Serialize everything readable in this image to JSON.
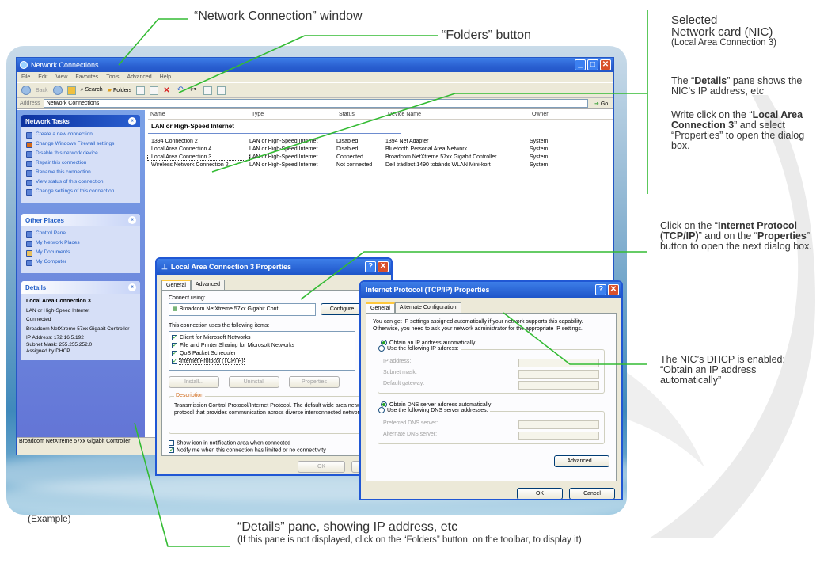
{
  "annotations": {
    "window_caption": "“Network Connection” window",
    "folders_caption": "“Folders” button",
    "nic_title_1": "Selected",
    "nic_title_2": "Network card (NIC)",
    "nic_title_3": "(Local Area Connection 3)",
    "details_note_1": "The “",
    "details_note_b": "Details",
    "details_note_2": "” pane shows the NIC’s IP address, etc",
    "write_1": "Write click on the “",
    "write_b": "Local Area Connection 3",
    "write_2": "” and select “Properties” to open the dialog box.",
    "tcp_1": "Click on the “",
    "tcp_b1": "Internet Protocol (TCP/IP)",
    "tcp_2": "” and on the “",
    "tcp_b2": "Properties",
    "tcp_3": "” button to open the next dialog box.",
    "dhcp_note": "The NIC’s DHCP is enabled: “Obtain an IP address automatically”",
    "example": "(Example)",
    "details_caption": "“Details” pane, showing IP address, etc",
    "details_sub": "(If this pane is not displayed, click on the “Folders” button, on the toolbar, to display it)"
  },
  "window": {
    "title": "Network Connections",
    "menu": [
      "File",
      "Edit",
      "View",
      "Favorites",
      "Tools",
      "Advanced",
      "Help"
    ],
    "toolbar": {
      "back": "Back",
      "search": "Search",
      "folders": "Folders"
    },
    "address_label": "Address",
    "address_value": "Network Connections",
    "go_label": "Go",
    "status_text": "Broadcom NetXtreme 57xx Gigabit Controller"
  },
  "left_pane": {
    "network_tasks": {
      "title": "Network Tasks",
      "items": [
        "Create a new connection",
        "Change Windows Firewall settings",
        "Disable this network device",
        "Repair this connection",
        "Rename this connection",
        "View status of this connection",
        "Change settings of this connection"
      ]
    },
    "other_places": {
      "title": "Other Places",
      "items": [
        "Control Panel",
        "My Network Places",
        "My Documents",
        "My Computer"
      ]
    },
    "details": {
      "title": "Details",
      "name": "Local Area Connection 3",
      "lines": [
        "LAN or High-Speed Internet",
        "Connected",
        "Broadcom NetXtreme 57xx Gigabit Controller",
        "IP Address: 172.16.5.192",
        "Subnet Mask: 255.255.252.0",
        "Assigned by DHCP"
      ]
    }
  },
  "connection_list": {
    "columns": [
      "Name",
      "Type",
      "Status",
      "Device Name",
      "Owner"
    ],
    "group": "LAN or High-Speed Internet",
    "rows": [
      [
        "1394 Connection 2",
        "LAN or High-Speed Internet",
        "Disabled",
        "1394 Net Adapter",
        "System"
      ],
      [
        "Local Area Connection 4",
        "LAN or High-Speed Internet",
        "Disabled",
        "Bluetooth Personal Area Network",
        "System"
      ],
      [
        "Local Area Connection 3",
        "LAN or High-Speed Internet",
        "Connected",
        "Broadcom NetXtreme 57xx Gigabit Controller",
        "System"
      ],
      [
        "Wireless Network Connection 2",
        "LAN or High-Speed Internet",
        "Not connected",
        "Dell trådløst 1490 tobånds WLAN Mini-kort",
        "System"
      ]
    ]
  },
  "lac_dialog": {
    "title": "Local Area Connection 3 Properties",
    "tabs": [
      "General",
      "Advanced"
    ],
    "connect_using": "Connect using:",
    "adapter": "Broadcom NetXtreme 57xx Gigabit Cont",
    "configure": "Configure...",
    "items_label": "This connection uses the following items:",
    "items": [
      "Client for Microsoft Networks",
      "File and Printer Sharing for Microsoft Networks",
      "QoS Packet Scheduler",
      "Internet Protocol (TCP/IP)"
    ],
    "install": "Install...",
    "uninstall": "Uninstall",
    "properties": "Properties",
    "description_label": "Description",
    "description": "Transmission Control Protocol/Internet Protocol. The default wide area network protocol that provides communication across diverse interconnected networks.",
    "show_icon": "Show icon in notification area when connected",
    "notify": "Notify me when this connection has limited or no connectivity",
    "ok": "OK",
    "cancel": "Ca"
  },
  "tcp_dialog": {
    "title": "Internet Protocol (TCP/IP) Properties",
    "tabs": [
      "General",
      "Alternate Configuration"
    ],
    "intro": "You can get IP settings assigned automatically if your network supports this capability. Otherwise, you need to ask your network administrator for the appropriate IP settings.",
    "obtain_ip": "Obtain an IP address automatically",
    "use_ip": "Use the following IP address:",
    "ip_fields": [
      "IP address:",
      "Subnet mask:",
      "Default gateway:"
    ],
    "obtain_dns": "Obtain DNS server address automatically",
    "use_dns": "Use the following DNS server addresses:",
    "dns_fields": [
      "Preferred DNS server:",
      "Alternate DNS server:"
    ],
    "advanced": "Advanced...",
    "ok": "OK",
    "cancel": "Cancel"
  },
  "colors": {
    "accent_green": "#33bb33",
    "xp_blue": "#2457c5"
  }
}
